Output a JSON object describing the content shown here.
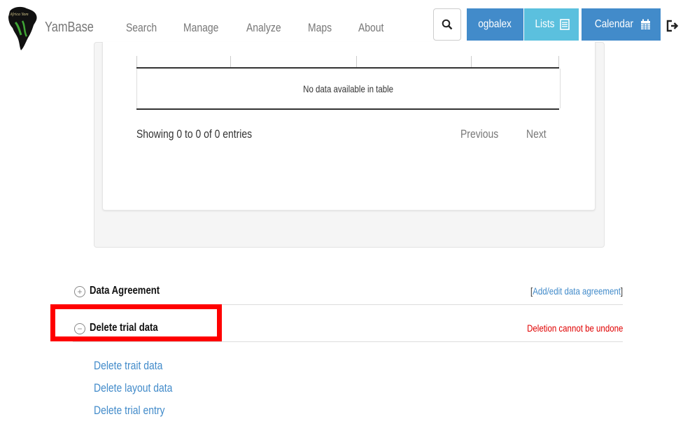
{
  "navbar": {
    "brand": "YamBase",
    "logo_text": "Africa Yam",
    "items": [
      {
        "label": "Search"
      },
      {
        "label": "Manage"
      },
      {
        "label": "Analyze"
      },
      {
        "label": "Maps"
      },
      {
        "label": "About"
      }
    ],
    "user_label": "ogbalex",
    "lists_label": "Lists",
    "calendar_label": "Calendar"
  },
  "table": {
    "empty_message": "No data available in table",
    "info": "Showing 0 to 0 of 0 entries",
    "previous_label": "Previous",
    "next_label": "Next"
  },
  "sections": {
    "data_agreement": {
      "title": "Data Agreement",
      "link_open": "[",
      "link_label": "Add/edit data agreement",
      "link_close": "]",
      "toggle": "+"
    },
    "delete_trial": {
      "title": "Delete trial data",
      "warning": "Deletion cannot be undone",
      "toggle": "−",
      "links": [
        "Delete trait data",
        "Delete layout data",
        "Delete trial entry"
      ]
    }
  },
  "colors": {
    "primary": "#428bca",
    "info": "#5bc0de",
    "danger": "#e00000",
    "highlight": "#ff0000"
  }
}
